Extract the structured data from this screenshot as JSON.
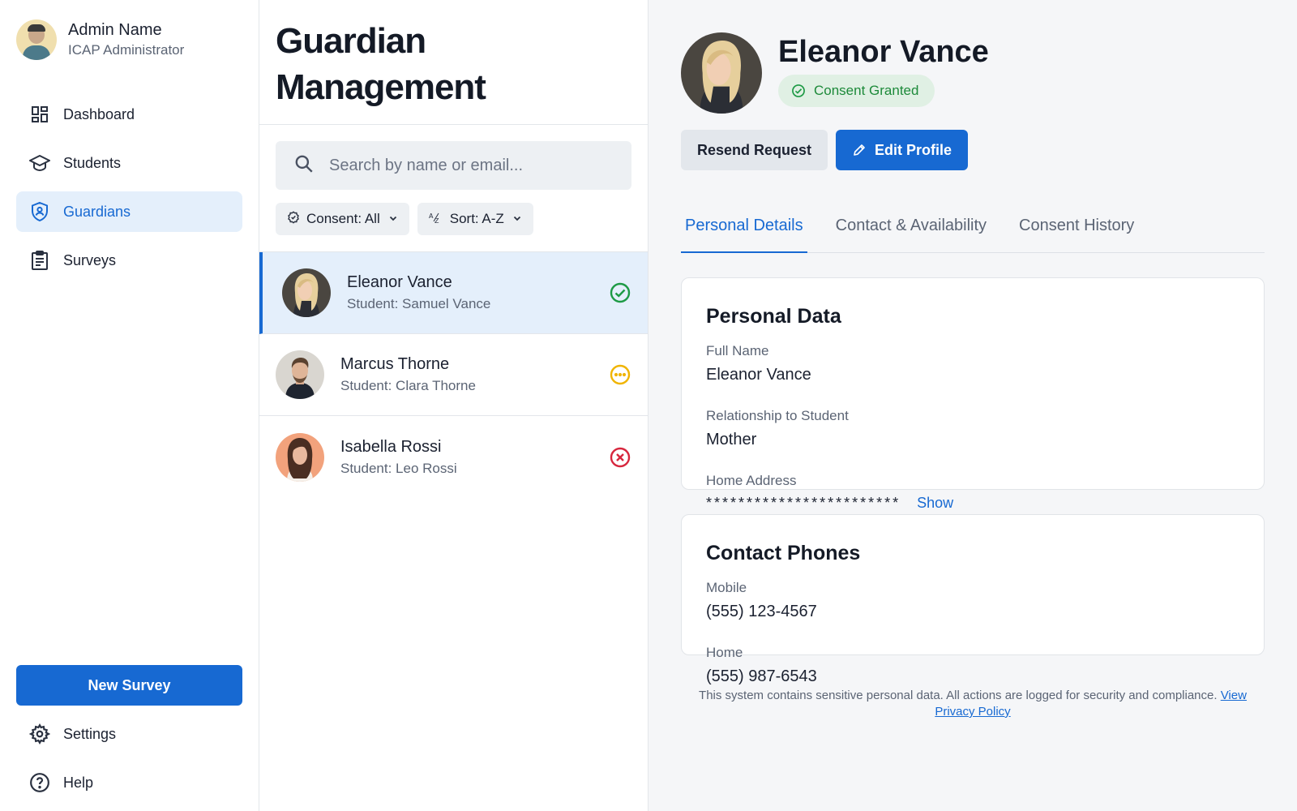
{
  "sidebar": {
    "profile": {
      "name": "Admin Name",
      "role": "ICAP Administrator"
    },
    "nav": [
      {
        "label": "Dashboard",
        "icon": "dashboard-icon",
        "active": false
      },
      {
        "label": "Students",
        "icon": "graduation-cap-icon",
        "active": false
      },
      {
        "label": "Guardians",
        "icon": "shield-user-icon",
        "active": true
      },
      {
        "label": "Surveys",
        "icon": "clipboard-icon",
        "active": false
      }
    ],
    "new_survey_label": "New Survey",
    "bottom_nav": [
      {
        "label": "Settings",
        "icon": "gear-icon"
      },
      {
        "label": "Help",
        "icon": "help-circle-icon"
      }
    ]
  },
  "list": {
    "title_line1": "Guardian",
    "title_line2": "Management",
    "search_placeholder": "Search by name or email...",
    "filters": {
      "consent_label": "Consent: All",
      "sort_label": "Sort: A-Z"
    },
    "guardians": [
      {
        "name": "Eleanor Vance",
        "student": "Student: Samuel Vance",
        "status": "granted",
        "selected": true
      },
      {
        "name": "Marcus Thorne",
        "student": "Student: Clara Thorne",
        "status": "pending",
        "selected": false
      },
      {
        "name": "Isabella Rossi",
        "student": "Student: Leo Rossi",
        "status": "denied",
        "selected": false
      }
    ]
  },
  "detail": {
    "name": "Eleanor Vance",
    "consent_badge": "Consent Granted",
    "actions": {
      "resend": "Resend Request",
      "edit": "Edit Profile"
    },
    "tabs": [
      "Personal Details",
      "Contact & Availability",
      "Consent History"
    ],
    "active_tab": "Personal Details",
    "personal": {
      "title": "Personal Data",
      "full_name_label": "Full Name",
      "full_name": "Eleanor Vance",
      "relationship_label": "Relationship to Student",
      "relationship": "Mother",
      "address_label": "Home Address",
      "address_masked": "************************",
      "show_label": "Show"
    },
    "phones": {
      "title": "Contact Phones",
      "mobile_label": "Mobile",
      "mobile": "(555) 123-4567",
      "home_label": "Home",
      "home": "(555) 987-6543"
    },
    "footer_text": "This system contains sensitive personal data. All actions are logged for security and compliance.",
    "footer_link": "View Privacy Policy"
  },
  "colors": {
    "accent": "#1769d2",
    "granted": "#1d9a45",
    "pending": "#f0b400",
    "denied": "#d7263d",
    "selected_bg": "#e4effb"
  }
}
